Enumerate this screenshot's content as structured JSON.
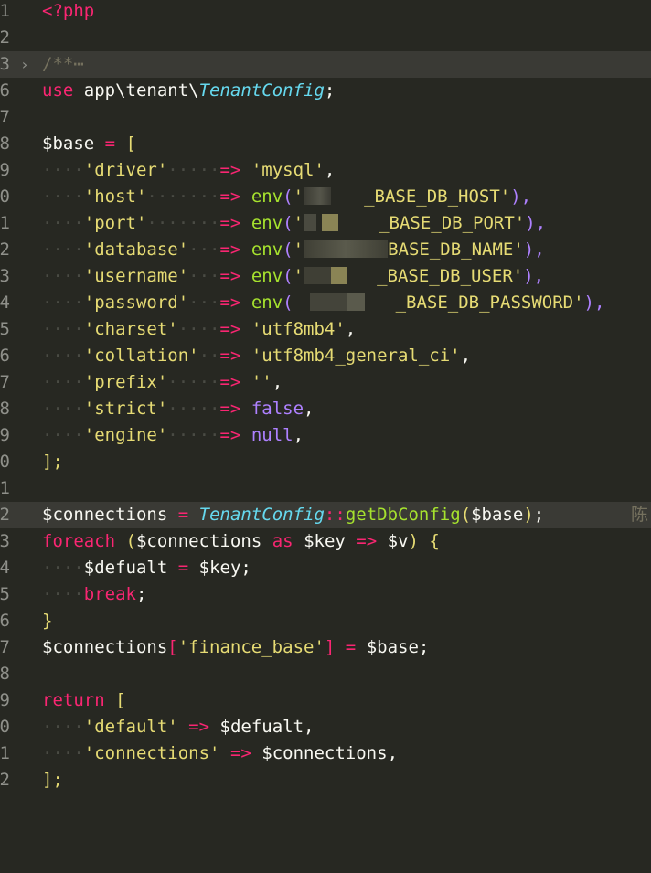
{
  "gutter": [
    "1",
    "2",
    "3",
    "6",
    "7",
    "8",
    "9",
    "0",
    "1",
    "2",
    "3",
    "4",
    "5",
    "6",
    "7",
    "8",
    "9",
    "0",
    "1",
    "2",
    "3",
    "4",
    "5",
    "6",
    "7",
    "8",
    "9",
    "0",
    "1",
    "2"
  ],
  "code": {
    "php_open": "<?php",
    "fold_comment": "/**",
    "fold_ellipsis": "⋯",
    "use_kw": "use",
    "use_ns": "app\\tenant\\",
    "use_class": "TenantConfig",
    "base_var": "$base",
    "assign": "=",
    "open_bracket": "[",
    "entries": [
      {
        "key": "'driver'",
        "dots": "·····",
        "fn": "",
        "arg_pre": "",
        "arg": "'mysql'",
        "arg_post": "",
        "tail": ","
      },
      {
        "key": "'host'",
        "dots": "·······",
        "fn": "env",
        "arg_pre": "'",
        "arg": "_BASE_DB_HOST'",
        "arg_post": "",
        "tail": "),"
      },
      {
        "key": "'port'",
        "dots": "·······",
        "fn": "env",
        "arg_pre": "'",
        "arg": "_BASE_DB_PORT'",
        "arg_post": "",
        "tail": "),"
      },
      {
        "key": "'database'",
        "dots": "···",
        "fn": "env",
        "arg_pre": "'",
        "arg": "BASE_DB_NAME'",
        "arg_post": "",
        "tail": "),"
      },
      {
        "key": "'username'",
        "dots": "···",
        "fn": "env",
        "arg_pre": "'",
        "arg": "_BASE_DB_USER'",
        "arg_post": "",
        "tail": "),"
      },
      {
        "key": "'password'",
        "dots": "···",
        "fn": "env",
        "arg_pre": "",
        "arg": "_BASE_DB_PASSWORD'",
        "arg_post": "",
        "tail": "),"
      },
      {
        "key": "'charset'",
        "dots": "····",
        "fn": "",
        "arg_pre": "",
        "arg": "'utf8mb4'",
        "arg_post": "",
        "tail": ","
      },
      {
        "key": "'collation'",
        "dots": "··",
        "fn": "",
        "arg_pre": "",
        "arg": "'utf8mb4_general_ci'",
        "arg_post": "",
        "tail": ","
      },
      {
        "key": "'prefix'",
        "dots": "·····",
        "fn": "",
        "arg_pre": "",
        "arg": "''",
        "arg_post": "",
        "tail": ","
      },
      {
        "key": "'strict'",
        "dots": "·····",
        "fn": "",
        "arg_pre": "",
        "arg": "false",
        "arg_post": "",
        "tail": ","
      },
      {
        "key": "'engine'",
        "dots": "·····",
        "fn": "",
        "arg_pre": "",
        "arg": "null",
        "arg_post": "",
        "tail": ","
      }
    ],
    "arrow": "=>",
    "close_bracket": "];",
    "connections_var": "$connections",
    "static_sep": "::",
    "get_db_config": "getDbConfig",
    "paren_open": "(",
    "paren_close": ")",
    "semicolon": ";",
    "blame_text": "陈",
    "foreach_kw": "foreach",
    "as_kw": "as",
    "key_var": "$key",
    "v_var": "$v",
    "brace_open": "{",
    "brace_close": "}",
    "defualt_var": "$defualt",
    "break_kw": "break",
    "finance_key": "'finance_base'",
    "return_kw": "return",
    "default_key": "'default'",
    "connections_key": "'connections'",
    "comma": ","
  }
}
